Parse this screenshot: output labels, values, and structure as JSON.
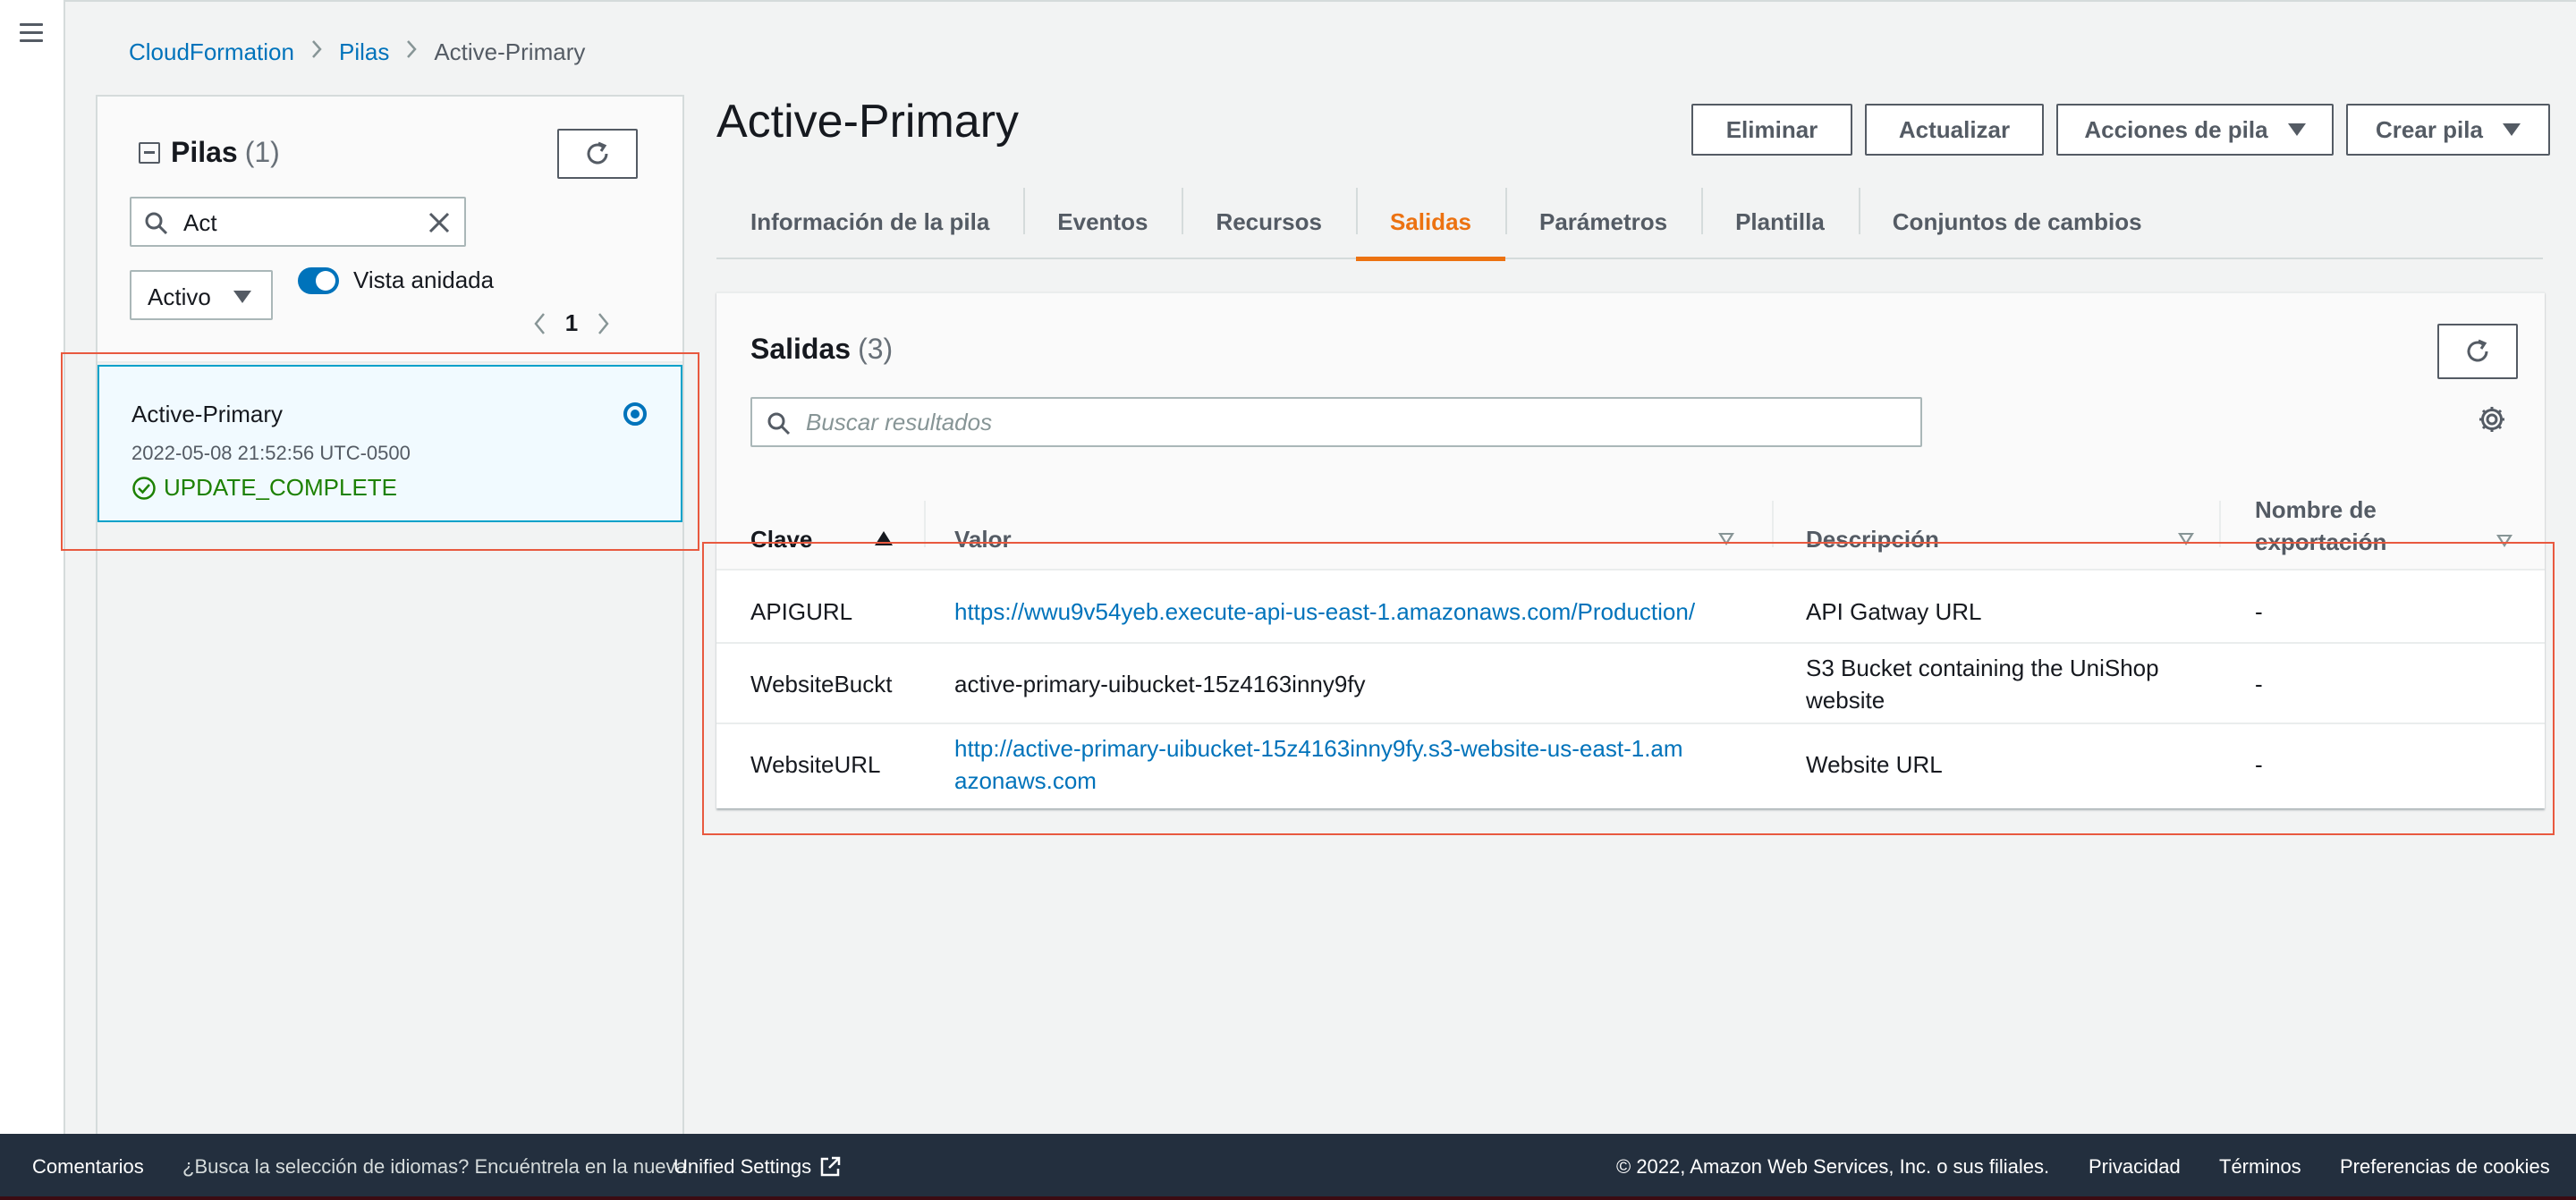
{
  "breadcrumb": {
    "items": [
      "CloudFormation",
      "Pilas"
    ],
    "current": "Active-Primary"
  },
  "stacks_panel": {
    "title": "Pilas",
    "count": "(1)",
    "search_value": "Act",
    "status_filter": "Activo",
    "nested_view_label": "Vista anidada",
    "nested_view_enabled": true,
    "page": "1",
    "stack": {
      "name": "Active-Primary",
      "date": "2022-05-08 21:52:56 UTC-0500",
      "status": "UPDATE_COMPLETE",
      "selected": true
    }
  },
  "header": {
    "title": "Active-Primary",
    "buttons": {
      "delete": "Eliminar",
      "update": "Actualizar",
      "stack_actions": "Acciones de pila",
      "create": "Crear pila"
    }
  },
  "tabs": [
    {
      "label": "Información de la pila",
      "active": false
    },
    {
      "label": "Eventos",
      "active": false
    },
    {
      "label": "Recursos",
      "active": false
    },
    {
      "label": "Salidas",
      "active": true
    },
    {
      "label": "Parámetros",
      "active": false
    },
    {
      "label": "Plantilla",
      "active": false
    },
    {
      "label": "Conjuntos de cambios",
      "active": false
    }
  ],
  "outputs": {
    "title": "Salidas",
    "count": "(3)",
    "search_placeholder": "Buscar resultados",
    "columns": [
      "Clave",
      "Valor",
      "Descripción",
      "Nombre de exportación"
    ],
    "rows": [
      {
        "key": "APIGURL",
        "value": "https://wwu9v54yeb.execute-api-us-east-1.amazonaws.com/Production/",
        "value_is_link": true,
        "description": "API Gatway URL",
        "export": "-"
      },
      {
        "key": "WebsiteBuckt",
        "value": "active-primary-uibucket-15z4163inny9fy",
        "value_is_link": false,
        "description": "S3 Bucket containing the UniShop website",
        "export": "-"
      },
      {
        "key": "WebsiteURL",
        "value": "http://active-primary-uibucket-15z4163inny9fy.s3-website-us-east-1.amazonaws.com",
        "value_is_link": true,
        "description": "Website URL",
        "export": "-"
      }
    ]
  },
  "footer": {
    "feedback": "Comentarios",
    "language_hint": "¿Busca la selección de idiomas? Encuéntrela en la nueva",
    "unified_settings": "Unified Settings",
    "copyright": "© 2022, Amazon Web Services, Inc. o sus filiales.",
    "privacy": "Privacidad",
    "terms": "Términos",
    "cookies": "Preferencias de cookies"
  },
  "colors": {
    "link": "#0073bb",
    "active_tab": "#ec7211",
    "success": "#1d8102",
    "footer_bg": "#232f3e",
    "annotation": "#e8593f"
  }
}
